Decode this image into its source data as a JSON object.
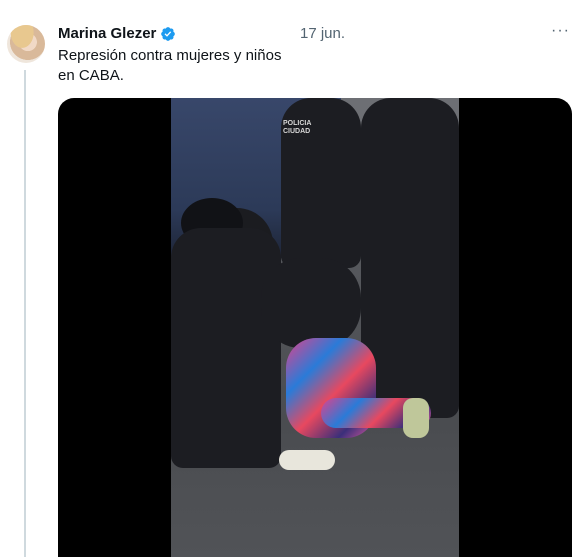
{
  "tweet": {
    "author_name": "Marina Glezer",
    "date": "17 jun.",
    "more_label": "···",
    "text": "Represión contra mujeres y niños en CABA."
  },
  "colors": {
    "verified_badge": "#1d9bf0",
    "secondary_text": "#536471",
    "thread_line": "#cfd9de"
  },
  "media": {
    "type": "video",
    "vest_text": "POLICIA CIUDAD"
  }
}
